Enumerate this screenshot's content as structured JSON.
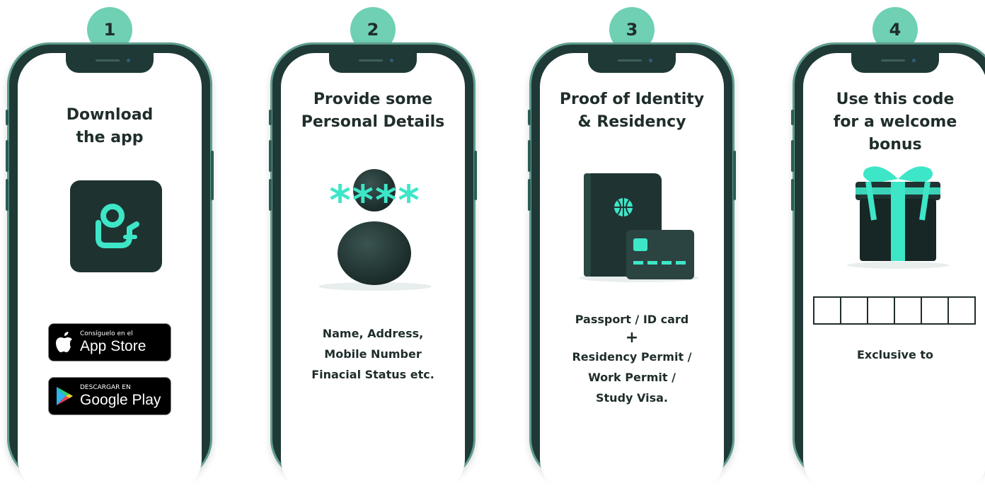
{
  "steps": [
    {
      "number": "1",
      "title_line1": "Download",
      "title_line2": "the app",
      "app_store": {
        "small": "Consíguelo en el",
        "big": "App Store"
      },
      "google_play": {
        "small": "DESCARGAR EN",
        "big": "Google Play"
      }
    },
    {
      "number": "2",
      "title_line1": "Provide some",
      "title_line2": "Personal Details",
      "password_mask": "****",
      "details": [
        "Name, Address,",
        "Mobile Number",
        "Finacial Status etc."
      ]
    },
    {
      "number": "3",
      "title_line1": "Proof of Identity",
      "title_line2": "& Residency",
      "docs": [
        "Passport / ID card",
        "+",
        "Residency Permit /",
        "Work Permit /",
        "Study Visa."
      ]
    },
    {
      "number": "4",
      "title_line1": "Use this code",
      "title_line2": "for a welcome",
      "title_line3": "bonus",
      "code_boxes": 6,
      "exclusive": "Exclusive to"
    }
  ],
  "colors": {
    "accent": "#6fd0b3",
    "phone_frame": "#1f3a36",
    "dark_icon": "#1e3330",
    "mint": "#3ee6c8"
  },
  "icons": [
    "app-logo-icon",
    "apple-icon",
    "google-play-icon",
    "person-icon",
    "passport-icon",
    "card-icon",
    "gift-icon"
  ]
}
